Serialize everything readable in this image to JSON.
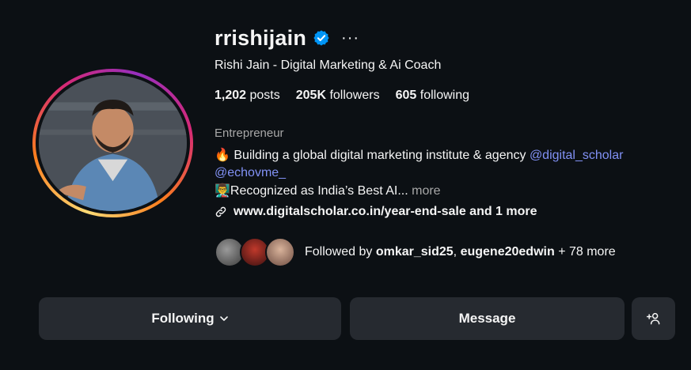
{
  "profile": {
    "username": "rrishijain",
    "full_name": "Rishi Jain - Digital Marketing & Ai Coach",
    "verified": true,
    "more_options": "···"
  },
  "stats": {
    "posts_count": "1,202",
    "posts_label": "posts",
    "followers_count": "205K",
    "followers_label": "followers",
    "following_count": "605",
    "following_label": "following"
  },
  "bio": {
    "category": "Entrepreneur",
    "line1_emoji": "🔥",
    "line1_text": "Building a global digital marketing institute & agency",
    "mention1": "@digital_scholar",
    "mention2": "@echovme_",
    "line3_emoji": "👨‍🏫",
    "line3_text": "Recognized as India’s Best AI...",
    "more_label": "more",
    "link_text": "www.digitalscholar.co.in/year-end-sale and 1 more"
  },
  "followed_by": {
    "prefix": "Followed by",
    "user1": "omkar_sid25",
    "separator": ",",
    "user2": "eugene20edwin",
    "suffix": "+ 78 more"
  },
  "actions": {
    "following_label": "Following",
    "message_label": "Message"
  },
  "colors": {
    "background": "#0c1014",
    "button": "#262a30",
    "mention": "#8191f5",
    "verified": "#0095f6"
  }
}
